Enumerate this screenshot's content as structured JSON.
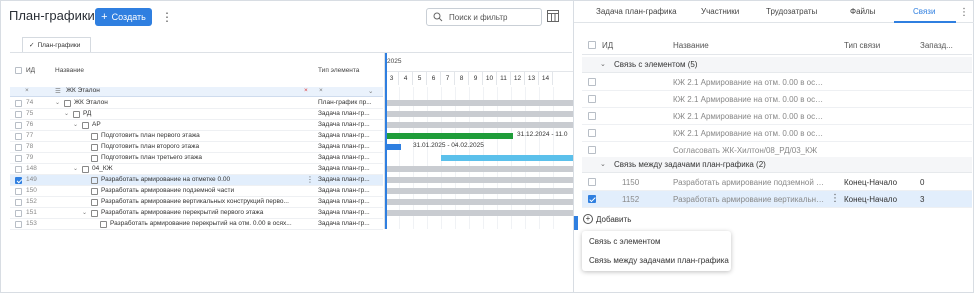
{
  "header": {
    "title": "План-графики",
    "create_label": "Создать",
    "search_placeholder": "Поиск и фильтр"
  },
  "sheet_tab": "План-графики",
  "grid": {
    "columns": {
      "id": "ИД",
      "name": "Название",
      "type": "Тип элемента"
    },
    "filter": {
      "name_value": "ЖК Эталон"
    },
    "rows": [
      {
        "id": "74",
        "name": "ЖК Эталон",
        "type": "План-график пр...",
        "indent": 0,
        "chevron": "⌄",
        "icon": "box",
        "checked": false,
        "selected": false
      },
      {
        "id": "75",
        "name": "РД",
        "type": "Задача план-гр...",
        "indent": 1,
        "chevron": "⌄",
        "icon": "doc",
        "checked": false,
        "selected": false
      },
      {
        "id": "76",
        "name": "АР",
        "type": "Задача план-гр...",
        "indent": 2,
        "chevron": "⌄",
        "icon": "doc",
        "checked": false,
        "selected": false
      },
      {
        "id": "77",
        "name": "Подготовить план первого этажа",
        "type": "Задача план-гр...",
        "indent": 3,
        "chevron": "",
        "icon": "doc",
        "checked": false,
        "selected": false
      },
      {
        "id": "78",
        "name": "Подготовить план второго этажа",
        "type": "Задача план-гр...",
        "indent": 3,
        "chevron": "",
        "icon": "doc",
        "checked": false,
        "selected": false
      },
      {
        "id": "79",
        "name": "Подготовить план третьего этажа",
        "type": "Задача план-гр...",
        "indent": 3,
        "chevron": "",
        "icon": "doc",
        "checked": false,
        "selected": false
      },
      {
        "id": "148",
        "name": "04_КЖ",
        "type": "Задача план-гр...",
        "indent": 2,
        "chevron": "⌄",
        "icon": "doc",
        "checked": false,
        "selected": false
      },
      {
        "id": "149",
        "name": "Разработать армирование на отметке 0.00",
        "type": "Задача план-гр...",
        "indent": 3,
        "chevron": "",
        "icon": "doc",
        "checked": true,
        "selected": true
      },
      {
        "id": "150",
        "name": "Разработать армирование подземной части",
        "type": "Задача план-гр...",
        "indent": 3,
        "chevron": "",
        "icon": "doc",
        "checked": false,
        "selected": false
      },
      {
        "id": "152",
        "name": "Разработать армирование вертикальных конструкций перво...",
        "type": "Задача план-гр...",
        "indent": 3,
        "chevron": "",
        "icon": "doc",
        "checked": false,
        "selected": false
      },
      {
        "id": "151",
        "name": "Разработать армирование перекрытий первого этажа",
        "type": "Задача план-гр...",
        "indent": 3,
        "chevron": "⌄",
        "icon": "doc",
        "checked": false,
        "selected": false
      },
      {
        "id": "153",
        "name": "Разработать армирование перекрытий на отм. 0.00 в осях...",
        "type": "Задача план-гр...",
        "indent": 4,
        "chevron": "",
        "icon": "doc",
        "checked": false,
        "selected": false
      }
    ]
  },
  "gantt": {
    "year": "2025",
    "days": [
      "3",
      "4",
      "5",
      "6",
      "7",
      "8",
      "9",
      "10",
      "11",
      "12",
      "13",
      "14"
    ],
    "bar_colors": {
      "summary": "#c9ccd1",
      "done": "#1f9d3a",
      "progress": "#2f7fe0",
      "planned": "#5bc0eb"
    },
    "label_1": "31.12.2024 - 11.0",
    "label_2": "31.01.2025 - 04.02.2025"
  },
  "panel": {
    "tabs": [
      "Задача план-графика",
      "Участники",
      "Трудозатраты",
      "Файлы",
      "Связи"
    ],
    "active_tab": "Связи",
    "columns": {
      "id": "ИД",
      "name": "Название",
      "type": "Тип связи",
      "lag": "Запазд..."
    },
    "group1": {
      "title": "Связь с элементом (5)",
      "rows": [
        {
          "name": "КЖ 2.1 Армирование на отм. 0.00 в осях..."
        },
        {
          "name": "КЖ 2.1 Армирование на отм. 0.00 в осях..."
        },
        {
          "name": "КЖ 2.1 Армирование на отм. 0.00 в осях..."
        },
        {
          "name": "КЖ 2.1 Армирование на отм. 0.00 в осях..."
        },
        {
          "name": "Согласовать ЖК-Хилтон/08_РД/03_КЖ"
        }
      ]
    },
    "group2": {
      "title": "Связь между задачами план-графика (2)",
      "rows": [
        {
          "id": "1150",
          "name": "Разработать армирование подземной ч...",
          "type": "Конец-Начало",
          "lag": "0",
          "checked": false
        },
        {
          "id": "1152",
          "name": "Разработать армирование вертикальны...",
          "type": "Конец-Начало",
          "lag": "3",
          "checked": true
        }
      ]
    },
    "add_label": "Добавить",
    "menu": [
      "Связь с элементом",
      "Связь между задачами план-графика"
    ]
  }
}
